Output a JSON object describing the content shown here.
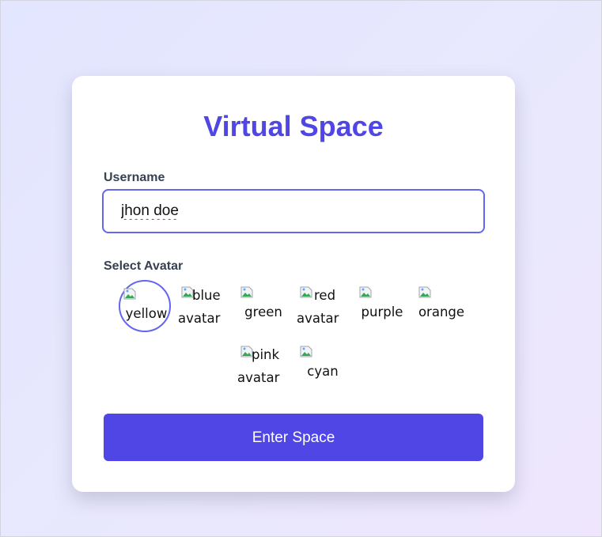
{
  "app": {
    "title": "Virtual Space"
  },
  "form": {
    "username_label": "Username",
    "username_value": "jhon doe",
    "avatar_label": "Select Avatar",
    "avatars": [
      {
        "alt": "yellow avatar",
        "line1": "yellow",
        "line2": "",
        "selected": true
      },
      {
        "alt": "blue avatar",
        "line1": "blue",
        "line2": "avatar",
        "selected": false
      },
      {
        "alt": "green avatar",
        "line1": "green",
        "line2": "",
        "selected": false
      },
      {
        "alt": "red avatar",
        "line1": "red",
        "line2": "avatar",
        "selected": false
      },
      {
        "alt": "purple avatar",
        "line1": "purple",
        "line2": "",
        "selected": false
      },
      {
        "alt": "orange avatar",
        "line1": "orange",
        "line2": "",
        "selected": false
      },
      {
        "alt": "pink avatar",
        "line1": "pink",
        "line2": "avatar",
        "selected": false
      },
      {
        "alt": "cyan avatar",
        "line1": "cyan",
        "line2": "",
        "selected": false
      }
    ],
    "submit_label": "Enter Space"
  },
  "colors": {
    "accent": "#4f46e5",
    "focus_ring": "#6366f1",
    "label": "#374151",
    "background": "#e5e7ff"
  }
}
